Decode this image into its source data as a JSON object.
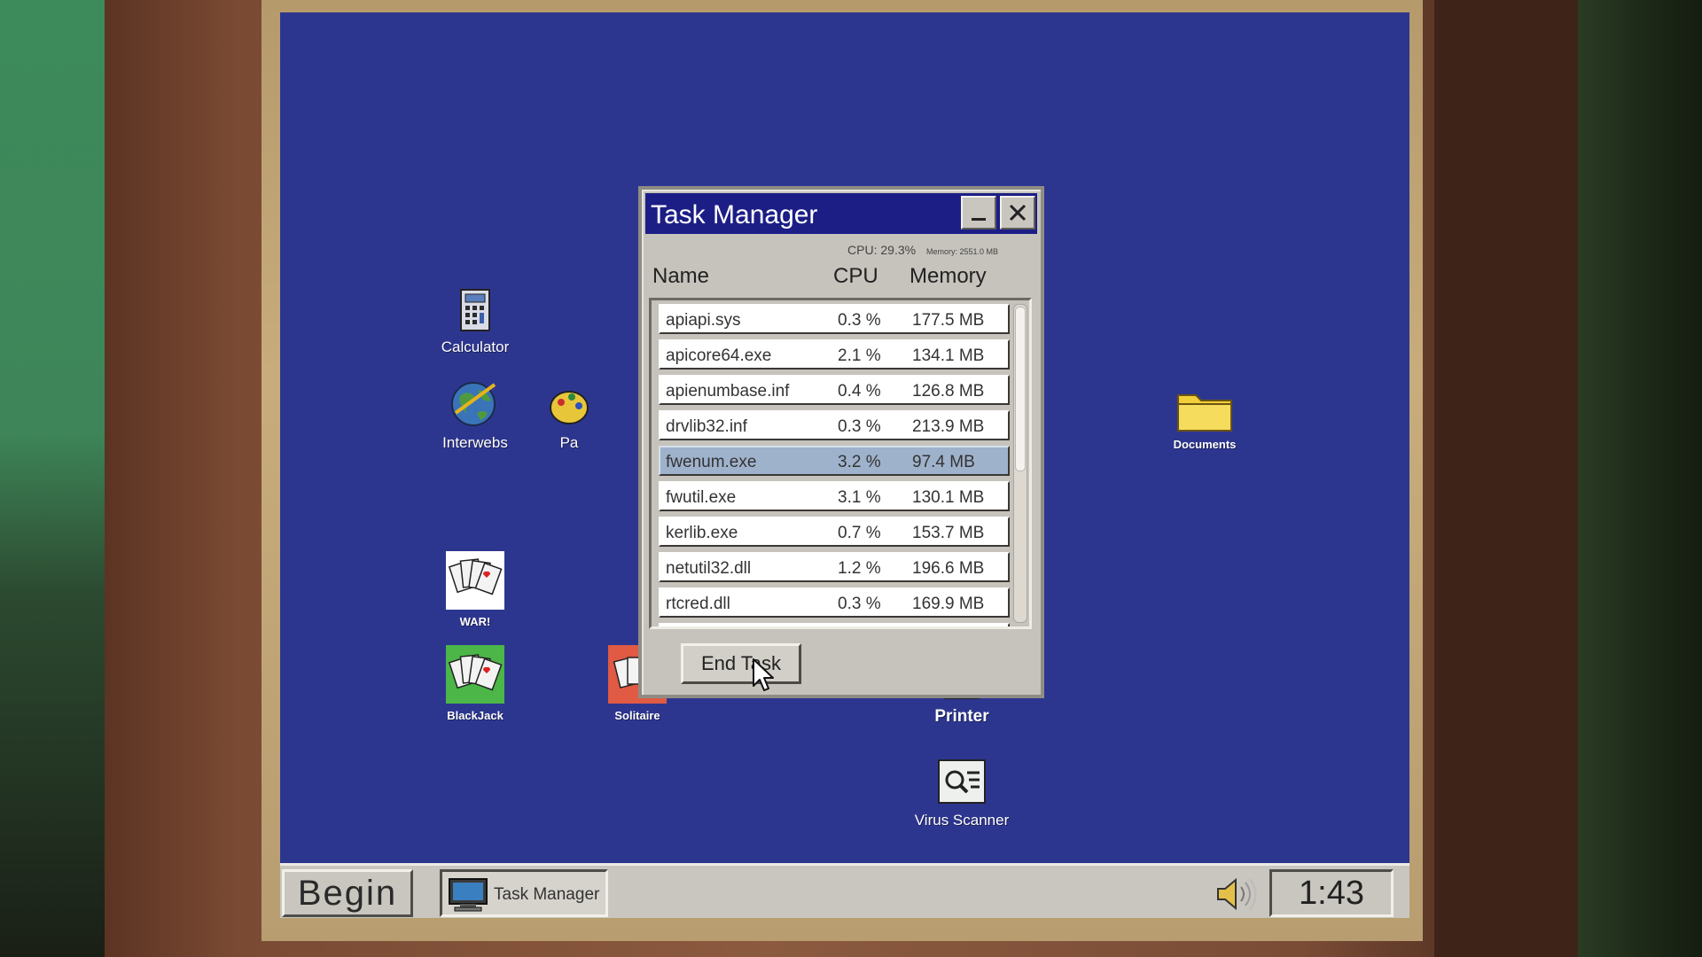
{
  "desktop": {
    "icons": {
      "calculator": "Calculator",
      "interwebs": "Interwebs",
      "paint": "Pa",
      "war": "WAR!",
      "blackjack": "BlackJack",
      "solitaire": "Solitaire",
      "documents": "Documents",
      "printer": "Printer",
      "virus_scanner": "Virus Scanner"
    }
  },
  "task_manager": {
    "title": "Task Manager",
    "cpu_total": "CPU: 29.3%",
    "memory_total": "Memory: 2551.0 MB",
    "columns": {
      "name": "Name",
      "cpu": "CPU",
      "memory": "Memory"
    },
    "processes": [
      {
        "name": "apiapi.sys",
        "cpu": "0.3 %",
        "memory": "177.5 MB"
      },
      {
        "name": "apicore64.exe",
        "cpu": "2.1 %",
        "memory": "134.1 MB"
      },
      {
        "name": "apienumbase.inf",
        "cpu": "0.4 %",
        "memory": "126.8 MB"
      },
      {
        "name": "drvlib32.inf",
        "cpu": "0.3 %",
        "memory": "213.9 MB"
      },
      {
        "name": "fwenum.exe",
        "cpu": "3.2 %",
        "memory": "97.4 MB"
      },
      {
        "name": "fwutil.exe",
        "cpu": "3.1 %",
        "memory": "130.1 MB"
      },
      {
        "name": "kerlib.exe",
        "cpu": "0.7 %",
        "memory": "153.7 MB"
      },
      {
        "name": "netutil32.dll",
        "cpu": "1.2 %",
        "memory": "196.6 MB"
      },
      {
        "name": "rtcred.dll",
        "cpu": "0.3 %",
        "memory": "169.9 MB"
      }
    ],
    "selected_process": "fwenum.exe",
    "end_task_label": "End Task"
  },
  "taskbar": {
    "begin_label": "Begin",
    "active_task_label": "Task Manager",
    "clock": "1:43 PM"
  },
  "colors": {
    "desktop": "#2d368f",
    "titlebar": "#1c1e86",
    "selection": "#9fb2cc",
    "chrome": "#c6c3bc"
  }
}
